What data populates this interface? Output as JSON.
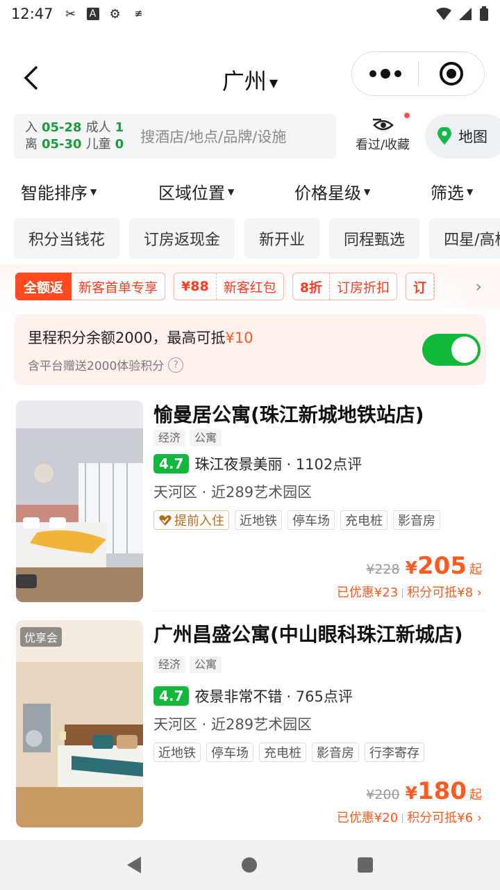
{
  "status_bar": {
    "time": "12:47"
  },
  "header": {
    "city": "广州"
  },
  "search": {
    "checkin_label": "入",
    "checkin_date": "05-28",
    "checkout_label": "离",
    "checkout_date": "05-30",
    "adults_label": "成人",
    "adults": "1",
    "children_label": "儿童",
    "children": "0",
    "placeholder": "搜酒店/地点/品牌/设施",
    "seen_label": "看过/收藏",
    "map_label": "地图"
  },
  "sort": {
    "items": [
      "智能排序",
      "区域位置",
      "价格星级",
      "筛选"
    ]
  },
  "chips": [
    "积分当钱花",
    "订房返现金",
    "新开业",
    "同程甄选",
    "四星/高档"
  ],
  "promo": {
    "badge": "全额返",
    "coupons": [
      {
        "amount": "",
        "text": "新客首单专享"
      },
      {
        "amount": "¥88",
        "text": "新客红包"
      },
      {
        "amount": "8折",
        "text": "订房折扣"
      },
      {
        "amount": "订",
        "text": ""
      }
    ]
  },
  "points": {
    "main_prefix": "里程积分余额2000，最高可抵",
    "main_amount": "¥10",
    "sub": "含平台赠送2000体验积分",
    "toggle_on": true
  },
  "hotels": [
    {
      "name": "愉曼居公寓(珠江新城地铁站店)",
      "tags": [
        "经济",
        "公寓"
      ],
      "score": "4.7",
      "highlight": "珠江夜景美丽",
      "reviews": "1102点评",
      "location": "天河区 · 近289艺术园区",
      "facilities": [
        "提前入住",
        "近地铁",
        "停车场",
        "充电桩",
        "影音房"
      ],
      "orig_price": "¥228",
      "currency": "¥",
      "price": "205",
      "price_suffix": "起",
      "discount": "已优惠¥23",
      "points_deduct": "积分可抵¥8",
      "badge": ""
    },
    {
      "name": "广州昌盛公寓(中山眼科珠江新城店)",
      "tags": [
        "经济",
        "公寓"
      ],
      "score": "4.7",
      "highlight": "夜景非常不错",
      "reviews": "765点评",
      "location": "天河区 · 近289艺术园区",
      "facilities": [
        "近地铁",
        "停车场",
        "充电桩",
        "影音房",
        "行李寄存"
      ],
      "orig_price": "¥200",
      "currency": "¥",
      "price": "180",
      "price_suffix": "起",
      "discount": "已优惠¥20",
      "points_deduct": "积分可抵¥6",
      "badge": "优享会"
    }
  ],
  "colors": {
    "green": "#12b83b",
    "orange": "#ff5a1f",
    "red": "#ff4a21"
  }
}
